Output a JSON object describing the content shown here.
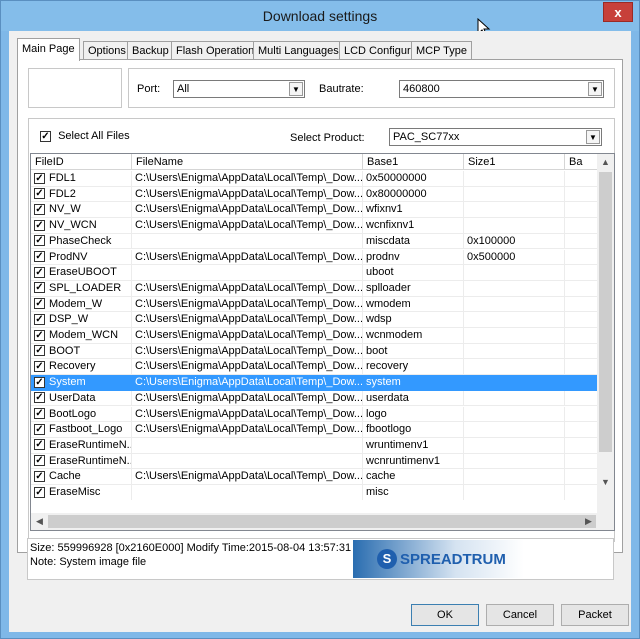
{
  "window": {
    "title": "Download settings",
    "close": "x"
  },
  "tabs": [
    "Main Page",
    "Options",
    "Backup",
    "Flash Operations",
    "Multi Languages",
    "LCD Configure",
    "MCP Type"
  ],
  "port": {
    "label": "Port:",
    "value": "All"
  },
  "bautrate": {
    "label": "Bautrate:",
    "value": "460800"
  },
  "select_all": {
    "label": "Select All Files",
    "checked": true
  },
  "product": {
    "label": "Select Product:",
    "value": "PAC_SC77xx"
  },
  "table": {
    "columns": [
      "FileID",
      "FileName",
      "Base1",
      "Size1",
      "Ba"
    ],
    "rows": [
      {
        "id": "FDL1",
        "file": "C:\\Users\\Enigma\\AppData\\Local\\Temp\\_Dow...",
        "base": "0x50000000",
        "size": "",
        "checked": true
      },
      {
        "id": "FDL2",
        "file": "C:\\Users\\Enigma\\AppData\\Local\\Temp\\_Dow...",
        "base": "0x80000000",
        "size": "",
        "checked": true
      },
      {
        "id": "NV_W",
        "file": "C:\\Users\\Enigma\\AppData\\Local\\Temp\\_Dow...",
        "base": "wfixnv1",
        "size": "",
        "checked": true
      },
      {
        "id": "NV_WCN",
        "file": "C:\\Users\\Enigma\\AppData\\Local\\Temp\\_Dow...",
        "base": "wcnfixnv1",
        "size": "",
        "checked": true
      },
      {
        "id": "PhaseCheck",
        "file": "",
        "base": "miscdata",
        "size": "0x100000",
        "checked": true
      },
      {
        "id": "ProdNV",
        "file": "C:\\Users\\Enigma\\AppData\\Local\\Temp\\_Dow...",
        "base": "prodnv",
        "size": "0x500000",
        "checked": true
      },
      {
        "id": "EraseUBOOT",
        "file": "",
        "base": "uboot",
        "size": "",
        "checked": true
      },
      {
        "id": "SPL_LOADER",
        "file": "C:\\Users\\Enigma\\AppData\\Local\\Temp\\_Dow...",
        "base": "splloader",
        "size": "",
        "checked": true
      },
      {
        "id": "Modem_W",
        "file": "C:\\Users\\Enigma\\AppData\\Local\\Temp\\_Dow...",
        "base": "wmodem",
        "size": "",
        "checked": true
      },
      {
        "id": "DSP_W",
        "file": "C:\\Users\\Enigma\\AppData\\Local\\Temp\\_Dow...",
        "base": "wdsp",
        "size": "",
        "checked": true
      },
      {
        "id": "Modem_WCN",
        "file": "C:\\Users\\Enigma\\AppData\\Local\\Temp\\_Dow...",
        "base": "wcnmodem",
        "size": "",
        "checked": true
      },
      {
        "id": "BOOT",
        "file": "C:\\Users\\Enigma\\AppData\\Local\\Temp\\_Dow...",
        "base": "boot",
        "size": "",
        "checked": true
      },
      {
        "id": "Recovery",
        "file": "C:\\Users\\Enigma\\AppData\\Local\\Temp\\_Dow...",
        "base": "recovery",
        "size": "",
        "checked": true
      },
      {
        "id": "System",
        "file": "C:\\Users\\Enigma\\AppData\\Local\\Temp\\_Dow...",
        "base": "system",
        "size": "",
        "checked": true,
        "selected": true
      },
      {
        "id": "UserData",
        "file": "C:\\Users\\Enigma\\AppData\\Local\\Temp\\_Dow...",
        "base": "userdata",
        "size": "",
        "checked": true
      },
      {
        "id": "BootLogo",
        "file": "C:\\Users\\Enigma\\AppData\\Local\\Temp\\_Dow...",
        "base": "logo",
        "size": "",
        "checked": true
      },
      {
        "id": "Fastboot_Logo",
        "file": "C:\\Users\\Enigma\\AppData\\Local\\Temp\\_Dow...",
        "base": "fbootlogo",
        "size": "",
        "checked": true
      },
      {
        "id": "EraseRuntimeN...",
        "file": "",
        "base": "wruntimenv1",
        "size": "",
        "checked": true
      },
      {
        "id": "EraseRuntimeN...",
        "file": "",
        "base": "wcnruntimenv1",
        "size": "",
        "checked": true
      },
      {
        "id": "Cache",
        "file": "C:\\Users\\Enigma\\AppData\\Local\\Temp\\_Dow...",
        "base": "cache",
        "size": "",
        "checked": true
      },
      {
        "id": "EraseMisc",
        "file": "",
        "base": "misc",
        "size": "",
        "checked": true
      }
    ]
  },
  "info": {
    "size_line": "Size: 559996928 [0x2160E000] Modify Time:2015-08-04 13:57:31",
    "note_line": "Note: System image file"
  },
  "logo": {
    "text": "SPREADTRUM",
    "mark": "S"
  },
  "buttons": {
    "ok": "OK",
    "cancel": "Cancel",
    "packet": "Packet"
  },
  "colors": {
    "selection": "#3399ff",
    "title_bar": "#84bdea",
    "close": "#c7403a",
    "logo": "#1f5fae"
  }
}
